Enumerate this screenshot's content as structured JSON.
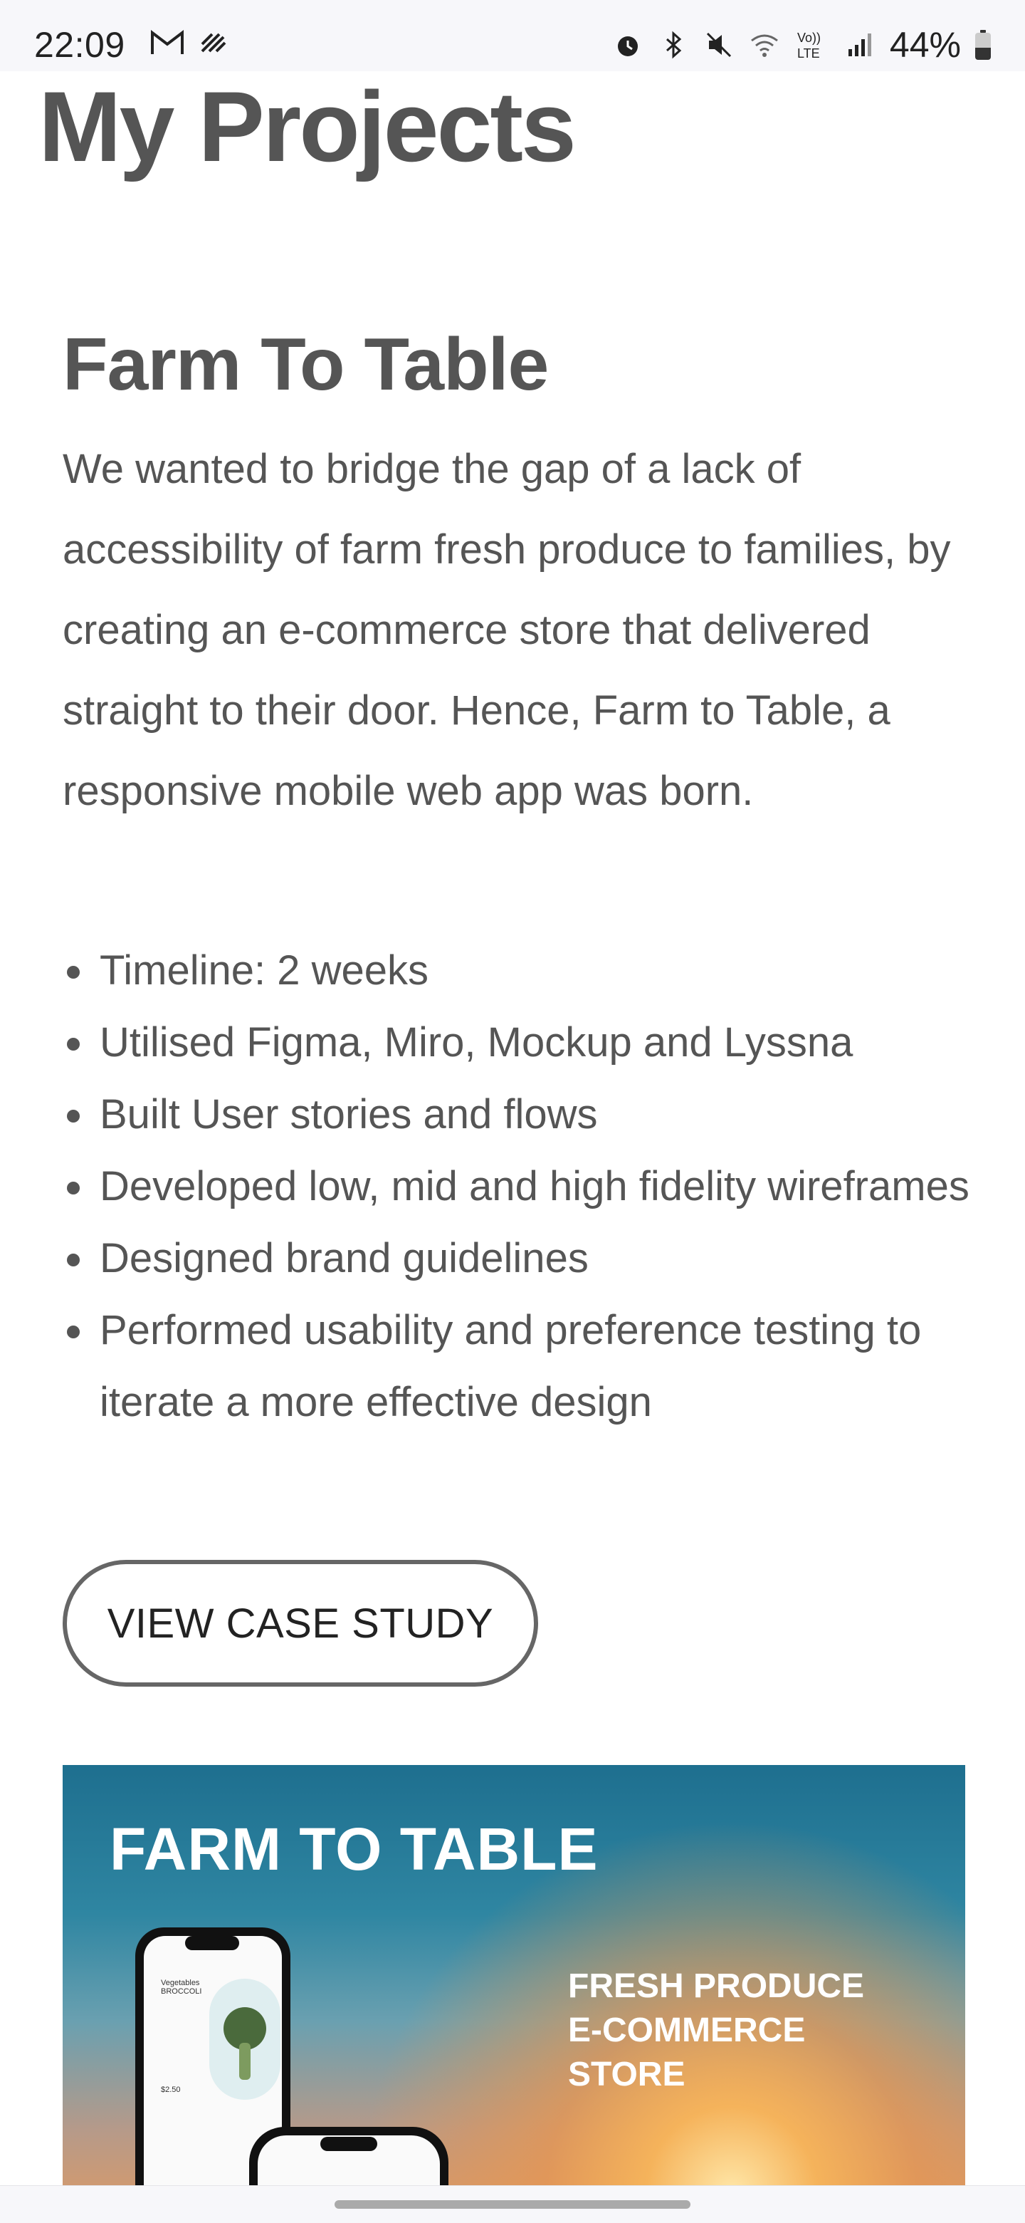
{
  "status_bar": {
    "time": "22:09",
    "left_icons": [
      "gmail-icon",
      "signal-stripes-icon"
    ],
    "right_icons": [
      "alarm-icon",
      "bluetooth-icon",
      "mute-icon",
      "wifi-icon",
      "volte-icon",
      "cell-signal-icon"
    ],
    "volte_label": "Vo)) LTE",
    "battery_percent": "44%",
    "battery_level": 0.44
  },
  "page": {
    "title": "My Projects"
  },
  "project": {
    "title": "Farm To Table",
    "description": "We wanted to bridge the gap of a lack of accessibility of farm fresh produce to families, by creating an e-commerce store that delivered straight to their door. Hence, Farm to Table, a responsive mobile web app was born.",
    "bullets": [
      "Timeline: 2 weeks",
      "Utilised Figma, Miro, Mockup and Lyssna",
      "Built User stories and flows",
      "Developed low, mid and high fidelity wireframes",
      "Designed brand guidelines",
      "Performed usability and preference testing to iterate a more effective design"
    ],
    "cta_label": "VIEW CASE STUDY"
  },
  "hero": {
    "title": "FARM TO TABLE",
    "subtitle_lines": [
      "FRESH PRODUCE",
      "E-COMMERCE",
      "STORE"
    ],
    "phone_labels": {
      "category": "Vegetables",
      "item": "BROCCOLI",
      "price": "$2.50"
    }
  },
  "colors": {
    "text": "#555555",
    "background": "#ffffff",
    "button_border": "#666666"
  }
}
